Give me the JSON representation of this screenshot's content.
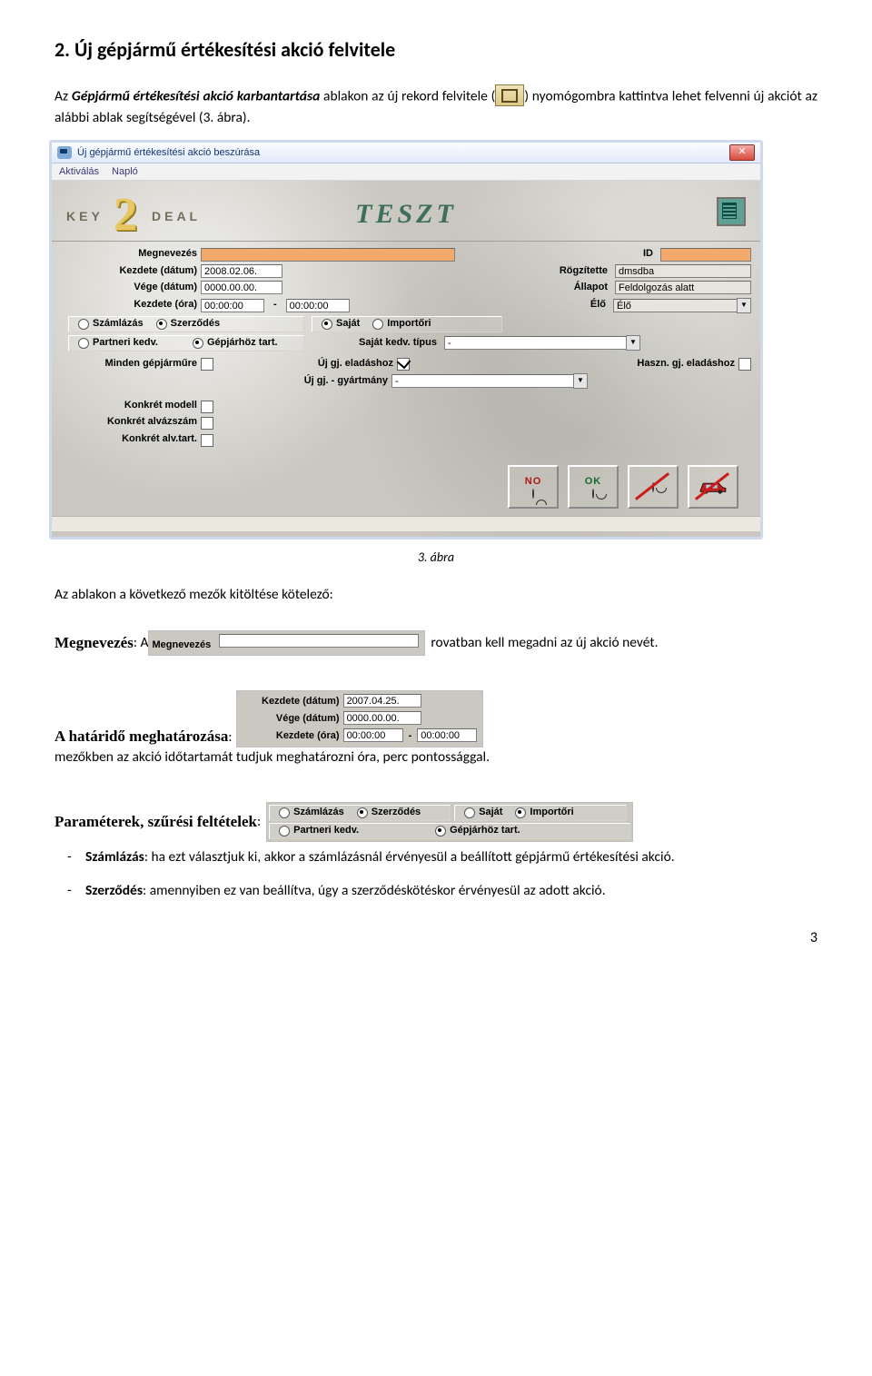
{
  "section_heading": "2. Új gépjármű értékesítési akció felvitele",
  "intro_part1": "Az ",
  "intro_bold_ital": "Gépjármű értékesítési akció karbantartása",
  "intro_part2": " ablakon az új rekord felvitele (",
  "intro_part3": ") nyomógombra kattintva lehet felvenni új akciót az alábbi ablak segítségével (3. ábra).",
  "dialog": {
    "title": "Új gépjármű értékesítési akció beszúrása",
    "menu": {
      "m1": "Aktiválás",
      "m2": "Napló"
    },
    "brand": {
      "key": "KEY",
      "num": "2",
      "deal": "DEAL",
      "teszt": "TESZT"
    },
    "labels": {
      "megnev": "Megnevezés",
      "id": "ID",
      "kezd_d": "Kezdete (dátum)",
      "rogz": "Rögzítette",
      "vege_d": "Vége (dátum)",
      "allapot": "Állapot",
      "kezd_o": "Kezdete (óra)",
      "elo": "Élő",
      "szaml": "Számlázás",
      "szerz": "Szerződés",
      "sajat": "Saját",
      "import": "Importőri",
      "partner": "Partneri kedv.",
      "gepj": "Gépjárhöz tart.",
      "sktip": "Saját kedv. típus",
      "minden": "Minden gépjárműre",
      "ujelad": "Új gj. eladáshoz",
      "haszn": "Haszn. gj. eladáshoz",
      "ujgyart": "Új gj. - gyártmány",
      "kmodell": "Konkrét modell",
      "kalvaz": "Konkrét alvázszám",
      "kalvtart": "Konkrét alv.tart."
    },
    "values": {
      "kezd_d": "2008.02.06.",
      "vege_d": "0000.00.00.",
      "kezd_o1": "00:00:00",
      "kezd_o2": "00:00:00",
      "rogz": "dmsdba",
      "allapot": "Feldolgozás alatt",
      "elo": "Élő",
      "sktip": "-",
      "ujgyart": "-"
    },
    "btns": {
      "no": "NO",
      "ok": "OK"
    }
  },
  "caption": "3. ábra",
  "after_caption": "Az ablakon a következő mezők kitöltése kötelező:",
  "megnev": {
    "lead": "Megnevezés",
    "colon": ": A ",
    "snip_label": "Megnevezés",
    "tail": " rovatban kell megadni az új akció nevét."
  },
  "hatarido": {
    "lead": "A határidő meghatározása",
    "colon": ": ",
    "snip": {
      "kezd_d": "Kezdete (dátum)",
      "kezd_d_v": "2007.04.25.",
      "vege_d": "Vége (dátum)",
      "vege_d_v": "0000.00.00.",
      "kezd_o": "Kezdete (óra)",
      "t1": "00:00:00",
      "t2": "00:00:00"
    },
    "tail": " mezőkben az akció időtartamát tudjuk meghatározni óra, perc pontossággal."
  },
  "param": {
    "lead": "Paraméterek, szűrési feltételek",
    "colon": ": ",
    "snip": {
      "szaml": "Számlázás",
      "szerz": "Szerződés",
      "sajat": "Saját",
      "import": "Importőri",
      "partner": "Partneri kedv.",
      "gepj": "Gépjárhöz tart."
    }
  },
  "list": {
    "item1_lead": "Számlázás",
    "item1_rest": ": ha ezt választjuk ki, akkor a számlázásnál érvényesül a beállított gépjármű értékesítési akció.",
    "item2_lead": "Szerződés",
    "item2_rest": ": amennyiben ez van beállítva, úgy a szerződéskötéskor érvényesül az adott akció."
  },
  "page_number": "3"
}
